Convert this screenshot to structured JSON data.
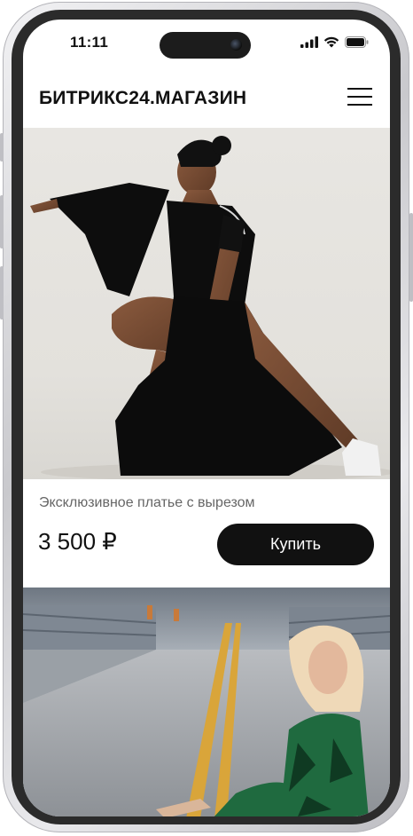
{
  "status_bar": {
    "time": "11:11",
    "icons": [
      "cellular-signal-icon",
      "wifi-icon",
      "battery-icon"
    ]
  },
  "header": {
    "brand": "БИТРИКС24.МАГАЗИН",
    "menu_icon": "hamburger-menu-icon"
  },
  "products": [
    {
      "name": "Эксклюзивное платье с вырезом",
      "price": "3 500 ₽",
      "buy_label": "Купить"
    }
  ],
  "colors": {
    "button_bg": "#111111",
    "button_text": "#ffffff",
    "text_primary": "#111111",
    "text_secondary": "#666666"
  }
}
